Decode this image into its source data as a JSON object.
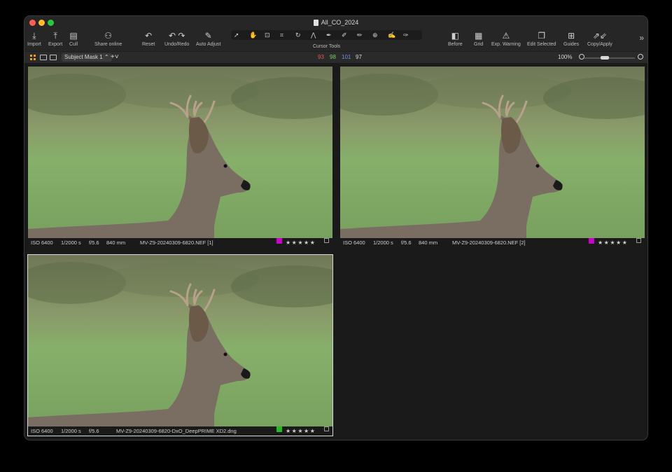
{
  "window": {
    "title": "All_CO_2024"
  },
  "toolbar": {
    "import": "Import",
    "export": "Export",
    "cull": "Cull",
    "share_online": "Share online",
    "reset": "Reset",
    "undo_redo": "Undo/Redo",
    "auto_adjust": "Auto Adjust",
    "cursor_tools": "Cursor Tools",
    "before": "Before",
    "grid": "Grid",
    "exp_warning": "Exp. Warning",
    "edit_selected": "Edit Selected",
    "guides": "Guides",
    "copy_apply": "Copy/Apply"
  },
  "subbar": {
    "mask_selector": "Subject Mask 1",
    "rgb": {
      "r": "93",
      "g": "98",
      "b": "101",
      "l": "97"
    },
    "zoom": "100%"
  },
  "images": [
    {
      "iso": "ISO 6400",
      "shutter": "1/2000 s",
      "aperture": "f/5.6",
      "focal": "840 mm",
      "filename": "MV-Z9-20240309-6820.NEF [1]",
      "color_tag": "#cc00cc",
      "stars": "★★★★★"
    },
    {
      "iso": "ISO 6400",
      "shutter": "1/2000 s",
      "aperture": "f/5.6",
      "focal": "840 mm",
      "filename": "MV-Z9-20240309-6820.NEF [2]",
      "color_tag": "#cc00cc",
      "stars": "★★★★★"
    },
    {
      "iso": "ISO 6400",
      "shutter": "1/2000 s",
      "aperture": "f/5.6",
      "filename": "MV-Z9-20240309-6820-DxO_DeepPRIME XD2.dng",
      "color_tag": "#22bb22",
      "stars": "★★★★★"
    }
  ],
  "colors": {
    "rgb_r": "#e05a4f",
    "rgb_g": "#7bd16b",
    "rgb_b": "#6f8fe0",
    "accent": "#f29b2a"
  }
}
